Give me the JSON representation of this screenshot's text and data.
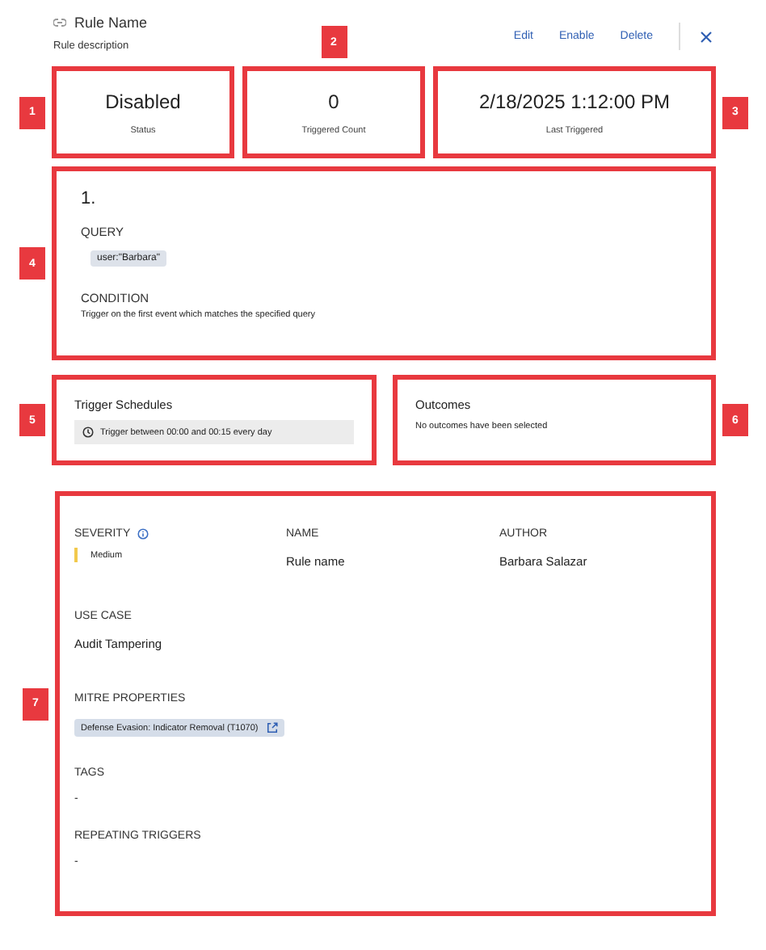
{
  "header": {
    "title": "Rule Name",
    "description": "Rule description",
    "actions": [
      "Edit",
      "Enable",
      "Delete"
    ]
  },
  "stats": [
    {
      "value": "Disabled",
      "label": "Status",
      "callout": "1"
    },
    {
      "value": "0",
      "label": "Triggered Count",
      "callout": "2"
    },
    {
      "value": "2/18/2025 1:12:00 PM",
      "label": "Last Triggered",
      "callout": "3"
    }
  ],
  "query_card": {
    "callout": "4",
    "index": "1.",
    "query_label": "QUERY",
    "query": "user:\"Barbara\"",
    "condition_label": "CONDITION",
    "condition": "Trigger on the first event which matches the specified query"
  },
  "schedules": {
    "callout": "5",
    "title": "Trigger Schedules",
    "items": [
      "Trigger between 00:00 and 00:15 every day"
    ]
  },
  "outcomes": {
    "callout": "6",
    "title": "Outcomes",
    "empty_text": "No outcomes have been selected"
  },
  "details": {
    "callout": "7",
    "severity": {
      "label": "SEVERITY",
      "value": "Medium"
    },
    "name": {
      "label": "NAME",
      "value": "Rule name"
    },
    "author": {
      "label": "AUTHOR",
      "value": "Barbara Salazar"
    },
    "use_case": {
      "label": "USE CASE",
      "value": "Audit Tampering"
    },
    "mitre": {
      "label": "MITRE PROPERTIES",
      "tags": [
        "Defense Evasion: Indicator Removal (T1070)"
      ]
    },
    "tags": {
      "label": "TAGS",
      "value": "-"
    },
    "repeating_triggers": {
      "label": "REPEATING TRIGGERS",
      "value": "-"
    }
  }
}
